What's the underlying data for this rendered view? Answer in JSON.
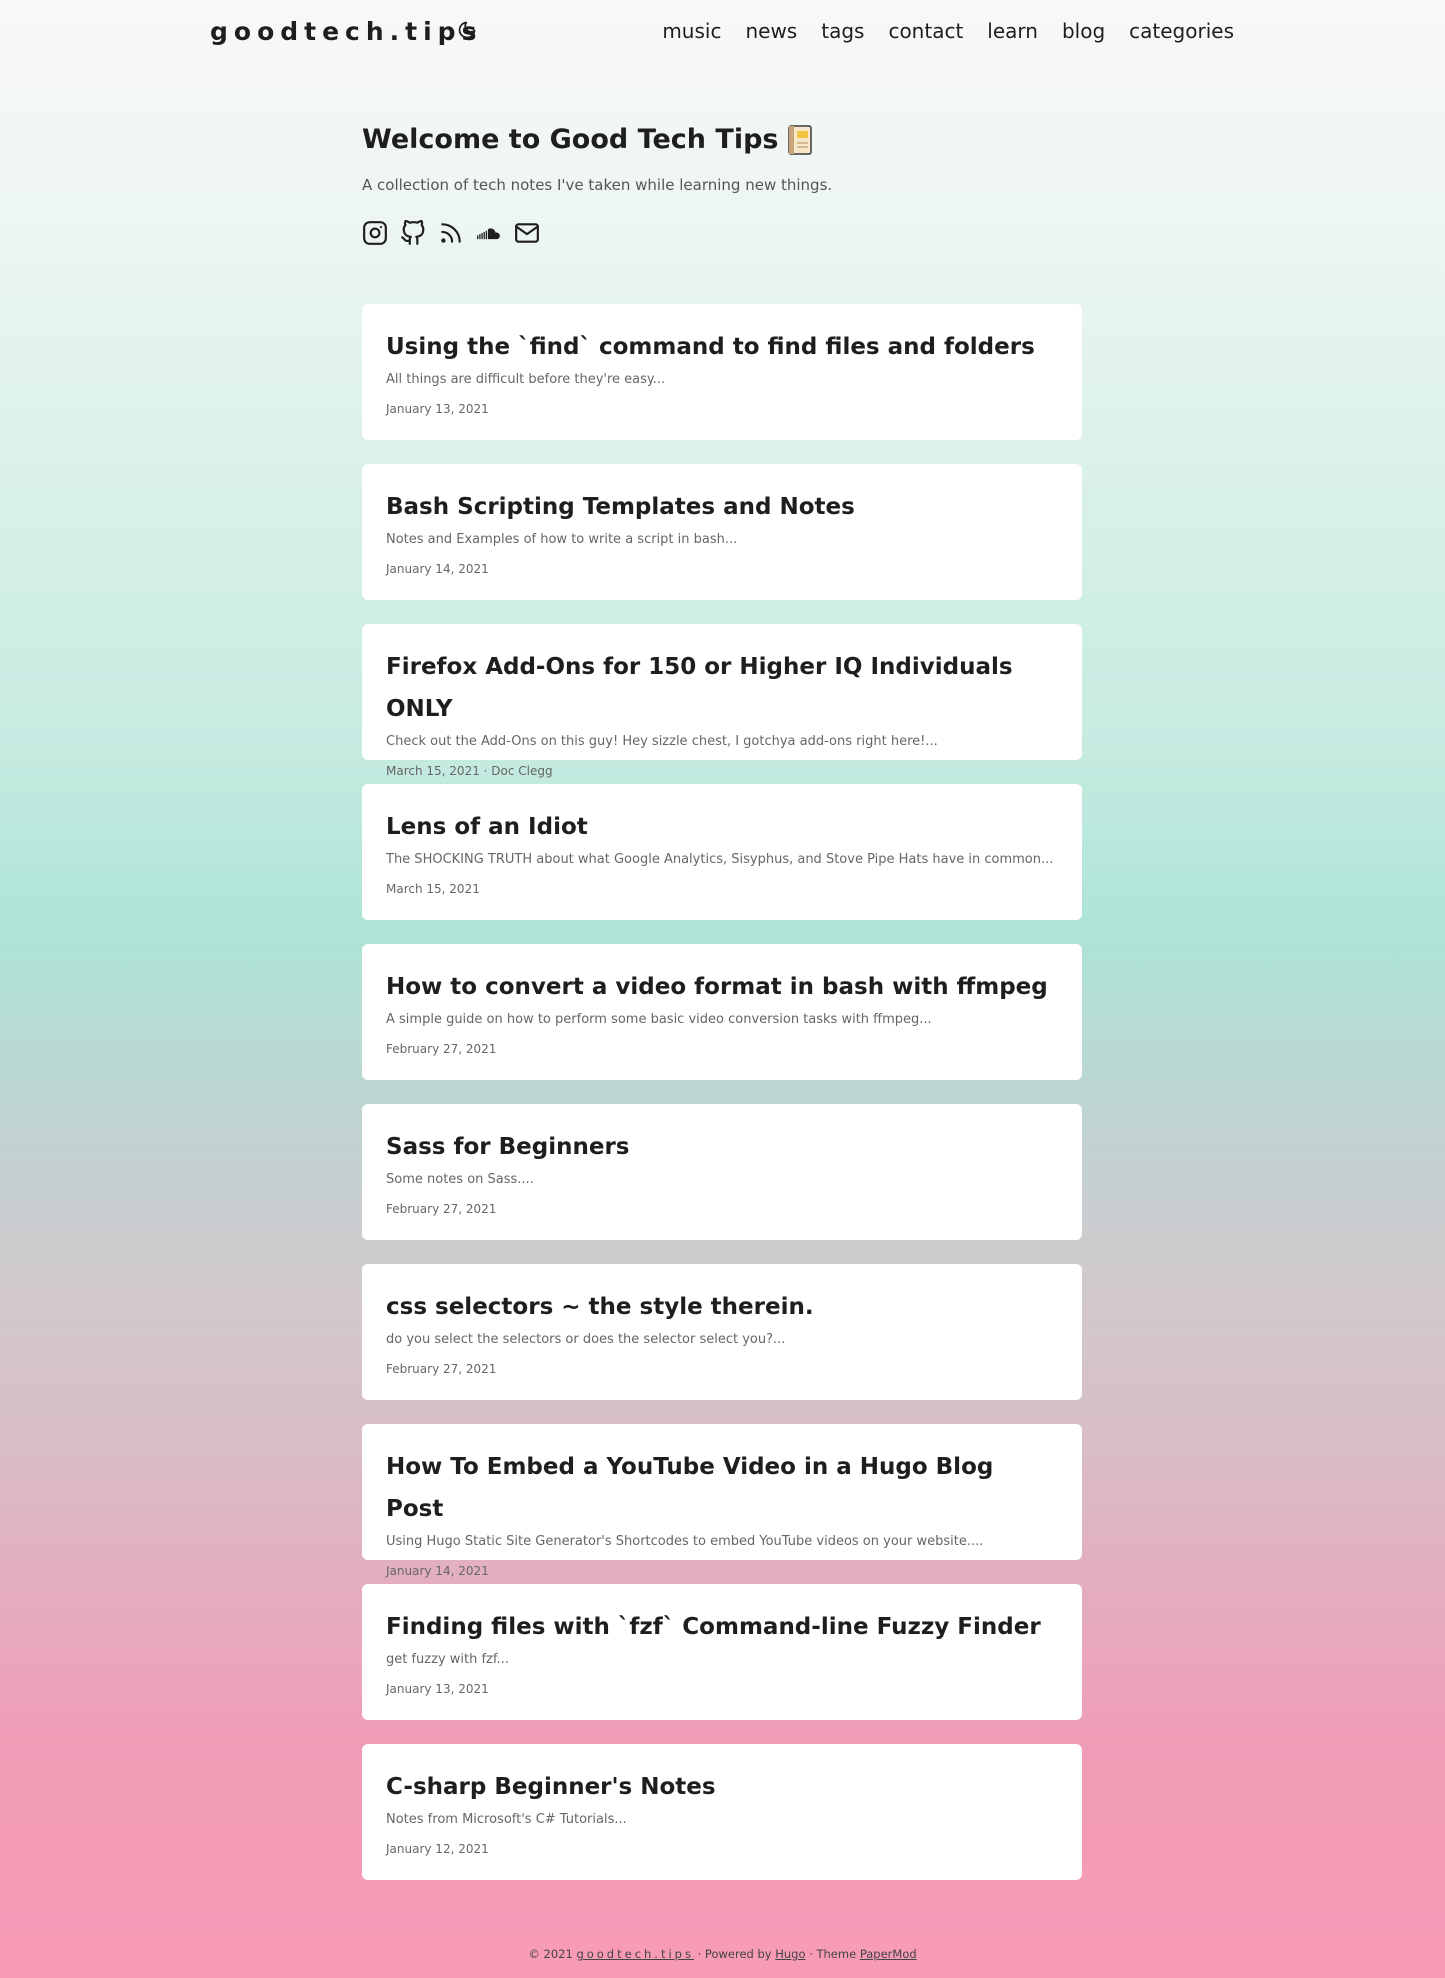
{
  "header": {
    "logo": "goodtech.tips",
    "nav": [
      "music",
      "news",
      "tags",
      "contact",
      "learn",
      "blog",
      "categories"
    ]
  },
  "intro": {
    "title": "Welcome to Good Tech Tips",
    "subtitle": "A collection of tech notes I've taken while learning new things.",
    "social_icons": [
      "instagram-icon",
      "github-icon",
      "rss-icon",
      "soundcloud-icon",
      "email-icon"
    ]
  },
  "posts": [
    {
      "title": "Using the `find` command to find files and folders",
      "summary": "All things are difficult before they're easy...",
      "meta": "January 13, 2021"
    },
    {
      "title": "Bash Scripting Templates and Notes",
      "summary": "Notes and Examples of how to write a script in bash...",
      "meta": "January 14, 2021"
    },
    {
      "title": "Firefox Add-Ons for 150 or Higher IQ Individuals ONLY",
      "summary": "Check out the Add-Ons on this guy! Hey sizzle chest, I gotchya add-ons right here!...",
      "meta": "March 15, 2021 · Doc Clegg"
    },
    {
      "title": "Lens of an Idiot",
      "summary": "The SHOCKING TRUTH about what Google Analytics, Sisyphus, and Stove Pipe Hats have in common...",
      "meta": "March 15, 2021"
    },
    {
      "title": "How to convert a video format in bash with ffmpeg",
      "summary": "A simple guide on how to perform some basic video conversion tasks with ffmpeg...",
      "meta": "February 27, 2021"
    },
    {
      "title": "Sass for Beginners",
      "summary": "Some notes on Sass....",
      "meta": "February 27, 2021"
    },
    {
      "title": "css selectors ~ the style therein.",
      "summary": "do you select the selectors or does the selector select you?...",
      "meta": "February 27, 2021"
    },
    {
      "title": "How To Embed a YouTube Video in a Hugo Blog Post",
      "summary": "Using Hugo Static Site Generator's Shortcodes to embed YouTube videos on your website....",
      "meta": "January 14, 2021"
    },
    {
      "title": "Finding files with `fzf` Command-line Fuzzy Finder",
      "summary": "get fuzzy with fzf...",
      "meta": "January 13, 2021"
    },
    {
      "title": "C-sharp Beginner's Notes",
      "summary": "Notes from Microsoft's C# Tutorials...",
      "meta": "January 12, 2021"
    }
  ],
  "footer": {
    "copyright": "© 2021",
    "site": "goodtech.tips",
    "powered_by": "· Powered by",
    "hugo": "Hugo",
    "theme": "· Theme",
    "papermod": "PaperMod"
  }
}
